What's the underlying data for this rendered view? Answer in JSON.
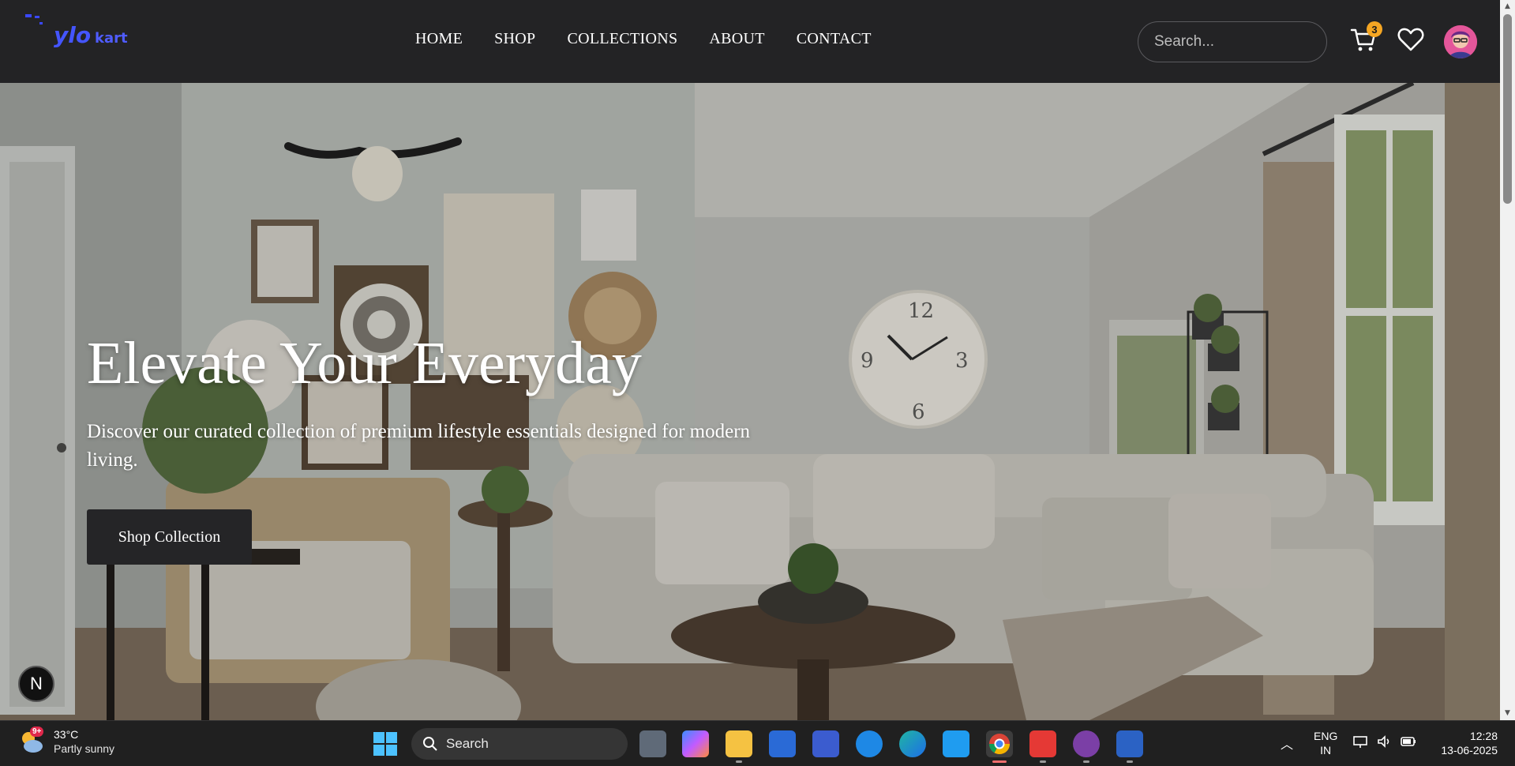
{
  "brand": {
    "logo_text": "ylokart"
  },
  "nav": {
    "items": [
      {
        "label": "HOME"
      },
      {
        "label": "SHOP"
      },
      {
        "label": "COLLECTIONS"
      },
      {
        "label": "ABOUT"
      },
      {
        "label": "CONTACT"
      }
    ]
  },
  "header": {
    "search_placeholder": "Search...",
    "cart_count": "3",
    "cart_icon": "cart-icon",
    "wishlist_icon": "heart-icon",
    "avatar_icon": "avatar"
  },
  "hero": {
    "title": "Elevate Your Everyday",
    "subtitle": "Discover our curated collection of premium lifestyle essentials designed for modern living.",
    "cta_label": "Shop Collection"
  },
  "dev_badge": {
    "letter": "N"
  },
  "taskbar": {
    "weather": {
      "temp": "33°C",
      "condition": "Partly sunny",
      "alert": "9+"
    },
    "search_label": "Search",
    "tray": {
      "lang_top": "ENG",
      "lang_bottom": "IN",
      "time": "12:28",
      "date": "13-06-2025"
    }
  },
  "colors": {
    "header_bg": "#232325",
    "badge": "#f5a623",
    "cta_bg": "#252527",
    "taskbar_bg": "#202020"
  }
}
